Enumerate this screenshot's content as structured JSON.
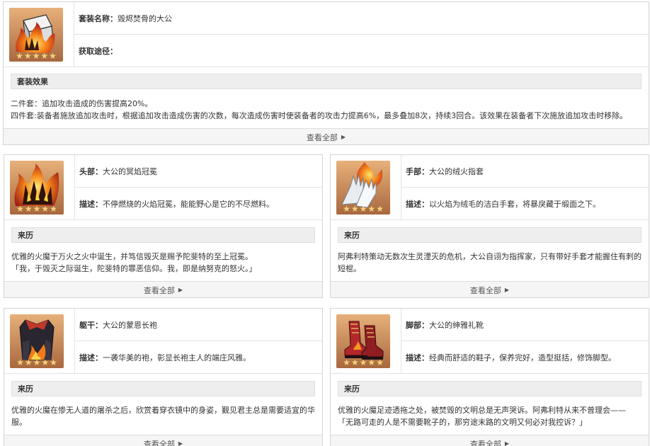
{
  "set": {
    "name_label": "套装名称：",
    "name_value": "毁烬焚骨的大公",
    "source_label": "获取途径：",
    "source_value": "",
    "effect_title": "套装效果",
    "effect_lines": [
      "二件套：追加攻击造成的伤害提高20%。",
      "四件套:装备者施放追加攻击时，根据追加攻击造成伤害的次数，每次造成伤害时使装备者的攻击力提高6%，最多叠加8次，持续3回合。该效果在装备者下次施放追加攻击时移除。"
    ],
    "view_all": "查看全部"
  },
  "pieces": [
    {
      "slot_label": "头部：",
      "name": "大公的冥焰冠冕",
      "desc_label": "描述：",
      "desc": "不停燃烧的火焰冠冕，能能野心是它的不尽燃料。",
      "lore_title": "来历",
      "lore_lines": [
        "优雅的火魔于万火之火中诞生，并笃信毁灭是赐予陀斐特的至上冠冕。",
        "「我，于毁灭之际诞生，陀斐特的罪恶信仰。我，即是纳努克的怒火。」"
      ],
      "view_all": "查看全部"
    },
    {
      "slot_label": "手部：",
      "name": "大公的绒火指套",
      "desc_label": "描述：",
      "desc": "以火焰为绒毛的洁白手套，将暴戾藏于缎面之下。",
      "lore_title": "来历",
      "lore_lines": [
        "阿弗利特策动无数次生灵湮灭的危机，大公自诩为指挥家，只有带好手套才能握住有刺的短棍。"
      ],
      "view_all": "查看全部"
    },
    {
      "slot_label": "躯干：",
      "name": "大公的蒙恩长袍",
      "desc_label": "描述：",
      "desc": "一袭华美的袍，彰显长袍主人的端庄风雅。",
      "lore_title": "来历",
      "lore_lines": [
        "优雅的火魔在惨无人道的屠杀之后，欣赏着穿衣镜中的身姿，觐见君主总是需要适宜的华服。"
      ],
      "view_all": "查看全部"
    },
    {
      "slot_label": "脚部：",
      "name": "大公的绅雅礼靴",
      "desc_label": "描述：",
      "desc": "经典而舒适的鞋子，保养完好，造型挺括，修饰脚型。",
      "lore_title": "来历",
      "lore_lines": [
        "优雅的火魔足迹透拖之处，被焚毁的文明总是无声哭诉。阿弗利特从来不曾理会——",
        "「无路可走的人是不需要靴子的，那穷途末路的文明又何必对我控诉？」"
      ],
      "view_all": "查看全部"
    }
  ],
  "icons": {
    "set": "burning-crown-box-icon",
    "head": "flaming-crown-icon",
    "hands": "white-gloves-icon",
    "body": "dark-robe-icon",
    "feet": "red-boots-icon",
    "stars": "star-icon",
    "arrow": "caret-right-icon"
  },
  "colors": {
    "thumb_bg": "#c98a5a",
    "star": "#f3d37a",
    "flame": "#f08a1c",
    "border": "#d4d4d4",
    "section_bg": "#eeeeee",
    "footer_bg": "#f5f5f5"
  },
  "rarity_stars": 5
}
